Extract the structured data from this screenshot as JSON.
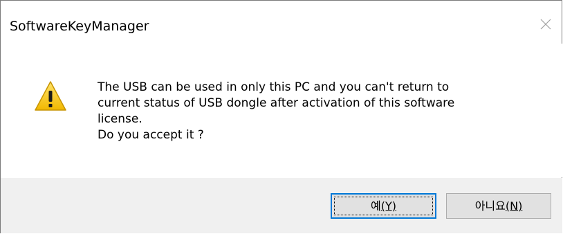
{
  "window": {
    "title": "SoftwareKeyManager",
    "close_icon": "close-icon"
  },
  "message": {
    "icon": "warning-icon",
    "lines": [
      "The USB can be used in only this PC and you can't return to",
      "current status of USB dongle after activation of this software",
      "license.",
      "Do you accept it ?"
    ]
  },
  "buttons": {
    "yes_label": "예",
    "yes_mnemonic": "(Y)",
    "no_label": "아니요",
    "no_mnemonic": "(N)"
  },
  "colors": {
    "button_bar": "#f0f0f0",
    "focus_border": "#0078d7",
    "warning_fill": "#f7c600"
  }
}
